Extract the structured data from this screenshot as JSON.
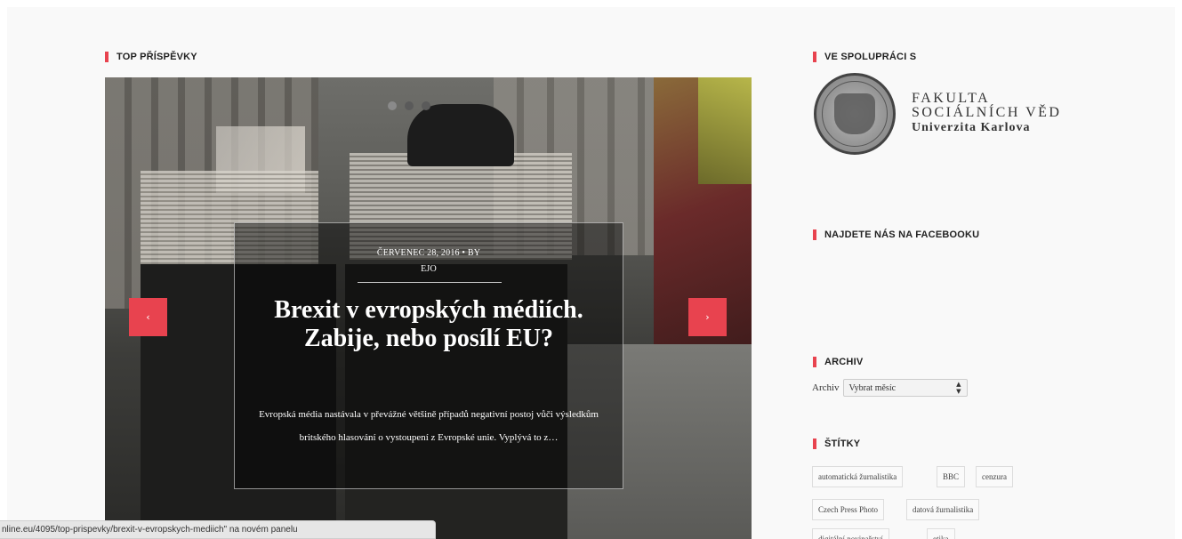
{
  "sections": {
    "top_posts": "TOP PŘÍSPĚVKY",
    "partner": "VE SPOLUPRÁCI S",
    "facebook": "NAJDETE NÁS NA FACEBOOKU",
    "archive": "ARCHIV",
    "tags": "ŠTÍTKY"
  },
  "slider": {
    "active_slide": 1,
    "slide_count": 3,
    "prev_label": "‹",
    "next_label": "›",
    "post": {
      "meta_line1": "ČERVENEC 28, 2016 • BY",
      "meta_line2": "EJO",
      "title": "Brexit v evropských médiích. Zabije, nebo posílí EU?",
      "excerpt": "Evropská média nastávala v převážné většině případů negativní postoj vůči výsledkům britského hlasování o vystoupení z Evropské unie. Vyplývá to z…"
    }
  },
  "partner_logo": {
    "line1": "FAKULTA",
    "line2": "SOCIÁLNÍCH VĚD",
    "line3": "Univerzita Karlova"
  },
  "archive": {
    "label": "Archiv",
    "select_value": "Vybrat měsíc"
  },
  "tags": [
    "automatická žurnalistika",
    "BBC",
    "cenzura",
    "Czech Press Photo",
    "datová žurnalistika",
    "digitální novinařství",
    "etika"
  ],
  "status_bar": {
    "text": "nline.eu/4095/top-prispevky/brexit-v-evropskych-mediich\" na novém panelu"
  },
  "colors": {
    "accent": "#e8434f",
    "page_bg": "#f9f9f9"
  }
}
